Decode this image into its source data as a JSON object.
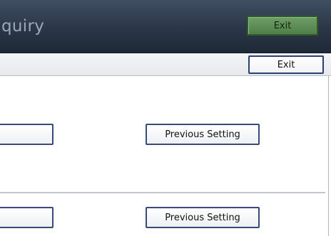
{
  "title_bar": {
    "title": "quiry",
    "exit_label": "Exit"
  },
  "sub_header": {
    "exit_label": "Exit"
  },
  "sections": [
    {
      "left_button_label": "",
      "previous_setting_label": "Previous Setting"
    },
    {
      "left_button_label": "",
      "previous_setting_label": "Previous Setting"
    }
  ],
  "colors": {
    "title_bar": "#2b3747",
    "title_text": "#9aa8bd",
    "title_exit_button": "#5a8a52",
    "button_border": "#3a4a78"
  }
}
